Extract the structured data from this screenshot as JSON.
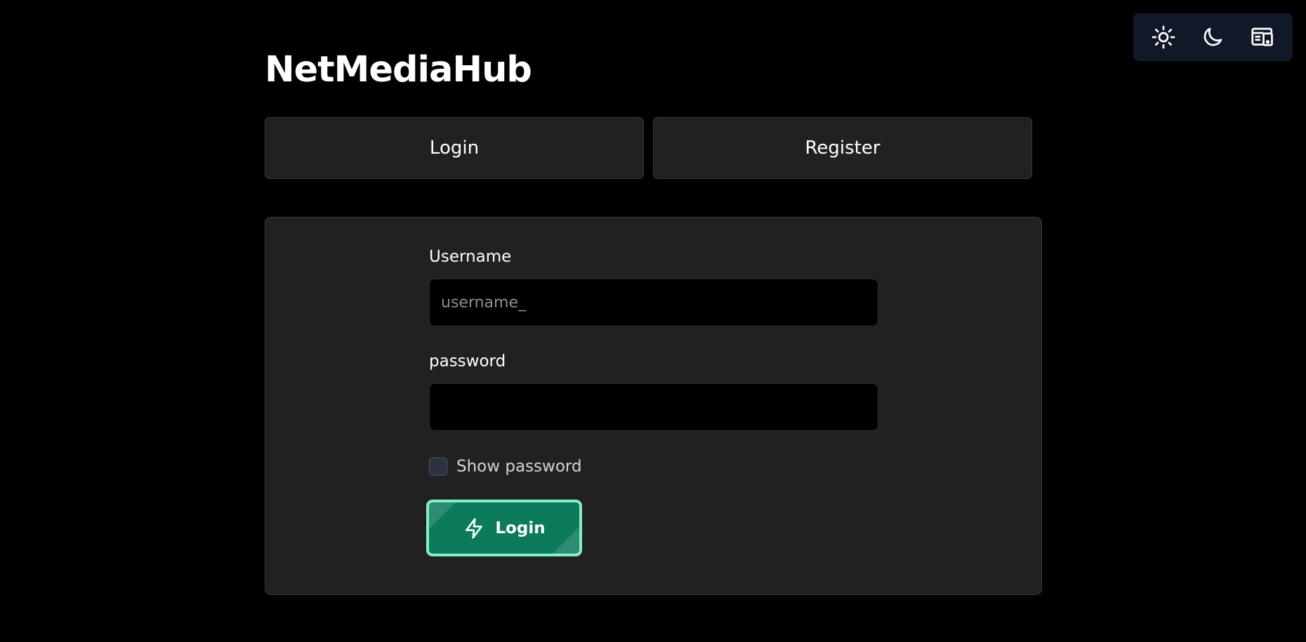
{
  "app": {
    "title": "NetMediaHub"
  },
  "theme_switcher": {
    "options": [
      {
        "name": "light",
        "icon": "sun-icon"
      },
      {
        "name": "dark",
        "icon": "moon-icon"
      },
      {
        "name": "system",
        "icon": "device-icon"
      }
    ]
  },
  "tabs": [
    {
      "label": "Login"
    },
    {
      "label": "Register"
    }
  ],
  "form": {
    "username_label": "Username",
    "username_placeholder": "username_",
    "username_value": "",
    "password_label": "password",
    "password_value": "",
    "show_password_label": "Show password",
    "show_password_checked": false,
    "submit_label": "Login",
    "submit_icon": "lightning-icon"
  },
  "colors": {
    "background": "#000000",
    "panel": "#212121",
    "accent": "#0b7a5a",
    "accent_border": "#86efc5",
    "switcher_bg": "#111827"
  }
}
